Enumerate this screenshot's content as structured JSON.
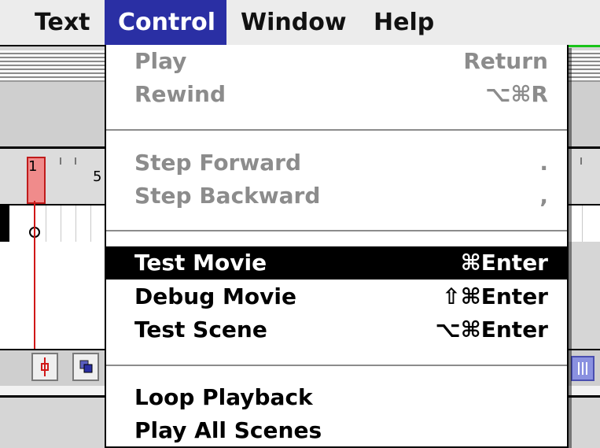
{
  "menubar": {
    "items": [
      {
        "label": "Text"
      },
      {
        "label": "Control",
        "active": true
      },
      {
        "label": "Window"
      },
      {
        "label": "Help"
      }
    ]
  },
  "timeline": {
    "frame_labels": [
      "1",
      "5"
    ]
  },
  "control_menu": {
    "groups": [
      [
        {
          "label": "Play",
          "shortcut": "Return",
          "enabled": false
        },
        {
          "label": "Rewind",
          "shortcut": "⌥⌘R",
          "enabled": false
        }
      ],
      [
        {
          "label": "Step Forward",
          "shortcut": ".",
          "enabled": false
        },
        {
          "label": "Step Backward",
          "shortcut": ",",
          "enabled": false
        }
      ],
      [
        {
          "label": "Test Movie",
          "shortcut": "⌘Enter",
          "enabled": true,
          "highlighted": true
        },
        {
          "label": "Debug Movie",
          "shortcut": "⇧⌘Enter",
          "enabled": true
        },
        {
          "label": "Test Scene",
          "shortcut": "⌥⌘Enter",
          "enabled": true
        }
      ],
      [
        {
          "label": "Loop Playback",
          "shortcut": "",
          "enabled": true
        },
        {
          "label": "Play All Scenes",
          "shortcut": "",
          "enabled": true
        }
      ]
    ]
  },
  "colors": {
    "menubar_active": "#2a2fa4",
    "playhead": "#d01818",
    "disabled_text": "#8c8c8c"
  }
}
